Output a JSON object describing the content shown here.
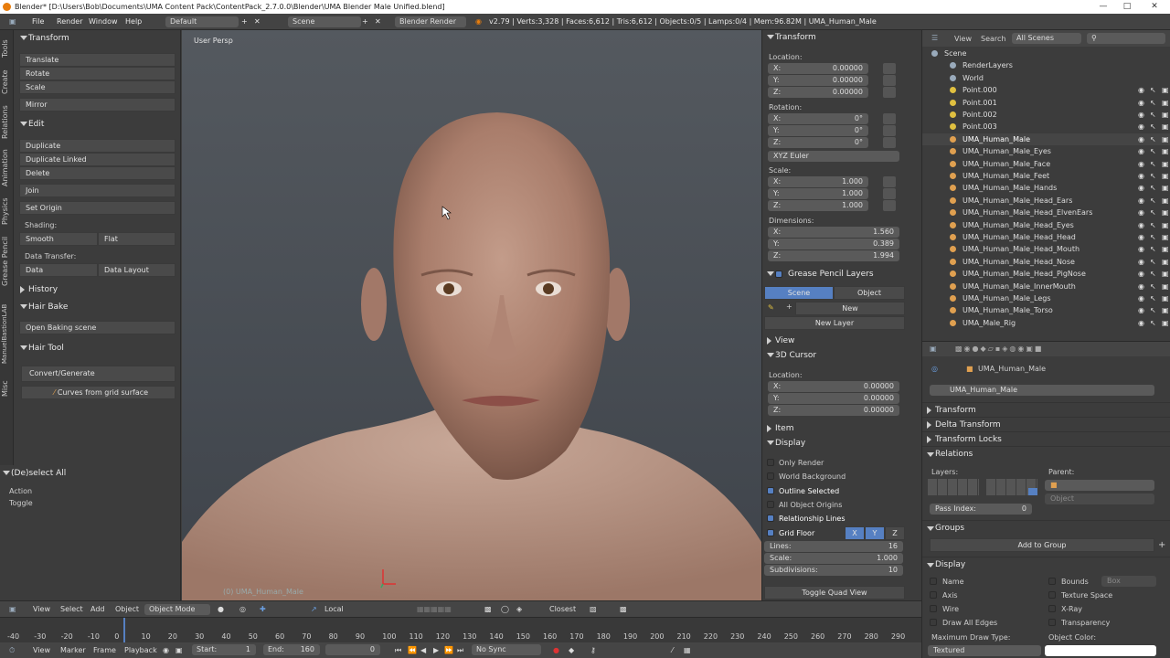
{
  "titlebar": {
    "title": "Blender* [D:\\Users\\Bob\\Documents\\UMA Content Pack\\ContentPack_2.7.0.0\\Blender\\UMA Blender Male Unified.blend]"
  },
  "menu": {
    "file": "File",
    "render": "Render",
    "window": "Window",
    "help": "Help",
    "layout": "Default",
    "scene": "Scene",
    "engine": "Blender Render",
    "stats": "v2.79 | Verts:3,328 | Faces:6,612 | Tris:6,612 | Objects:0/5 | Lamps:0/4 | Mem:96.82M | UMA_Human_Male"
  },
  "tabs": [
    "Tools",
    "Create",
    "Relations",
    "Animation",
    "Physics",
    "Grease Pencil",
    "ManuelBastionLAB",
    "Misc"
  ],
  "toolshelf": {
    "transform": "Transform",
    "translate": "Translate",
    "rotate": "Rotate",
    "scale": "Scale",
    "mirror": "Mirror",
    "edit": "Edit",
    "duplicate": "Duplicate",
    "duplicate_linked": "Duplicate Linked",
    "delete": "Delete",
    "join": "Join",
    "set_origin": "Set Origin",
    "shading": "Shading:",
    "smooth": "Smooth",
    "flat": "Flat",
    "data_transfer": "Data Transfer:",
    "data": "Data",
    "data_layout": "Data Layout",
    "history": "History",
    "hair_bake": "Hair Bake",
    "open_baking": "Open Baking scene",
    "hair_tool": "Hair Tool",
    "convert": "Convert/Generate",
    "curves": "Curves from grid surface"
  },
  "operator": {
    "title": "(De)select All",
    "action": "Action",
    "toggle": "Toggle"
  },
  "viewport": {
    "label": "User Persp",
    "object_label": "(0) UMA_Human_Male"
  },
  "view_header": {
    "view": "View",
    "select": "Select",
    "add": "Add",
    "object": "Object",
    "mode": "Object Mode",
    "pivot": "Local",
    "snap": "Closest"
  },
  "timeline": {
    "ticks": [
      "-40",
      "-30",
      "-20",
      "-10",
      "0",
      "10",
      "20",
      "30",
      "40",
      "50",
      "60",
      "70",
      "80",
      "90",
      "100",
      "110",
      "120",
      "130",
      "140",
      "150",
      "160",
      "170",
      "180",
      "190",
      "200",
      "210",
      "220",
      "230",
      "240",
      "250",
      "260",
      "270",
      "280",
      "290"
    ]
  },
  "timeline_header": {
    "view": "View",
    "marker": "Marker",
    "frame": "Frame",
    "playback": "Playback",
    "start_label": "Start:",
    "start": "1",
    "end_label": "End:",
    "end": "160",
    "current": "0",
    "sync": "No Sync"
  },
  "npanel": {
    "transform": "Transform",
    "location": "Location:",
    "rotation": "Rotation:",
    "euler": "XYZ Euler",
    "scale": "Scale:",
    "dimensions": "Dimensions:",
    "loc": [
      {
        "k": "X:",
        "v": "0.00000"
      },
      {
        "k": "Y:",
        "v": "0.00000"
      },
      {
        "k": "Z:",
        "v": "0.00000"
      }
    ],
    "rot": [
      {
        "k": "X:",
        "v": "0°"
      },
      {
        "k": "Y:",
        "v": "0°"
      },
      {
        "k": "Z:",
        "v": "0°"
      }
    ],
    "scl": [
      {
        "k": "X:",
        "v": "1.000"
      },
      {
        "k": "Y:",
        "v": "1.000"
      },
      {
        "k": "Z:",
        "v": "1.000"
      }
    ],
    "dim": [
      {
        "k": "X:",
        "v": "1.560"
      },
      {
        "k": "Y:",
        "v": "0.389"
      },
      {
        "k": "Z:",
        "v": "1.994"
      }
    ],
    "grease": "Grease Pencil Layers",
    "gp_scene": "Scene",
    "gp_object": "Object",
    "gp_new": "New",
    "gp_new_layer": "New Layer",
    "view": "View",
    "cursor": "3D Cursor",
    "cursor_location": "Location:",
    "cur": [
      {
        "k": "X:",
        "v": "0.00000"
      },
      {
        "k": "Y:",
        "v": "0.00000"
      },
      {
        "k": "Z:",
        "v": "0.00000"
      }
    ],
    "item": "Item",
    "display": "Display",
    "only_render": "Only Render",
    "world_bg": "World Background",
    "outline": "Outline Selected",
    "origins": "All Object Origins",
    "rel_lines": "Relationship Lines",
    "grid_floor": "Grid Floor",
    "gx": "X",
    "gy": "Y",
    "gz": "Z",
    "lines_k": "Lines:",
    "lines_v": "16",
    "scale_k": "Scale:",
    "scale_v": "1.000",
    "subdiv_k": "Subdivisions:",
    "subdiv_v": "10",
    "quad": "Toggle Quad View"
  },
  "outliner": {
    "view": "View",
    "search": "Search",
    "filter": "All Scenes",
    "items": [
      "Scene",
      "RenderLayers",
      "World",
      "Point.000",
      "Point.001",
      "Point.002",
      "Point.003",
      "UMA_Human_Male",
      "UMA_Human_Male_Eyes",
      "UMA_Human_Male_Face",
      "UMA_Human_Male_Feet",
      "UMA_Human_Male_Hands",
      "UMA_Human_Male_Head_Ears",
      "UMA_Human_Male_Head_ElvenEars",
      "UMA_Human_Male_Head_Eyes",
      "UMA_Human_Male_Head_Head",
      "UMA_Human_Male_Head_Mouth",
      "UMA_Human_Male_Head_Nose",
      "UMA_Human_Male_Head_PigNose",
      "UMA_Human_Male_InnerMouth",
      "UMA_Human_Male_Legs",
      "UMA_Human_Male_Torso",
      "UMA_Male_Rig"
    ]
  },
  "properties": {
    "context": "UMA_Human_Male",
    "name": "UMA_Human_Male",
    "transform": "Transform",
    "delta": "Delta Transform",
    "locks": "Transform Locks",
    "relations": "Relations",
    "layers": "Layers:",
    "parent": "Parent:",
    "parent_type": "Object",
    "pass_index_k": "Pass Index:",
    "pass_index_v": "0",
    "groups": "Groups",
    "add_group": "Add to Group",
    "display": "Display",
    "name_chk": "Name",
    "bounds": "Bounds",
    "bounds_type": "Box",
    "axis": "Axis",
    "tex_space": "Texture Space",
    "wire": "Wire",
    "xray": "X-Ray",
    "draw_edges": "Draw All Edges",
    "transparency": "Transparency",
    "max_draw": "Maximum Draw Type:",
    "max_draw_v": "Textured",
    "obj_color": "Object Color:"
  }
}
